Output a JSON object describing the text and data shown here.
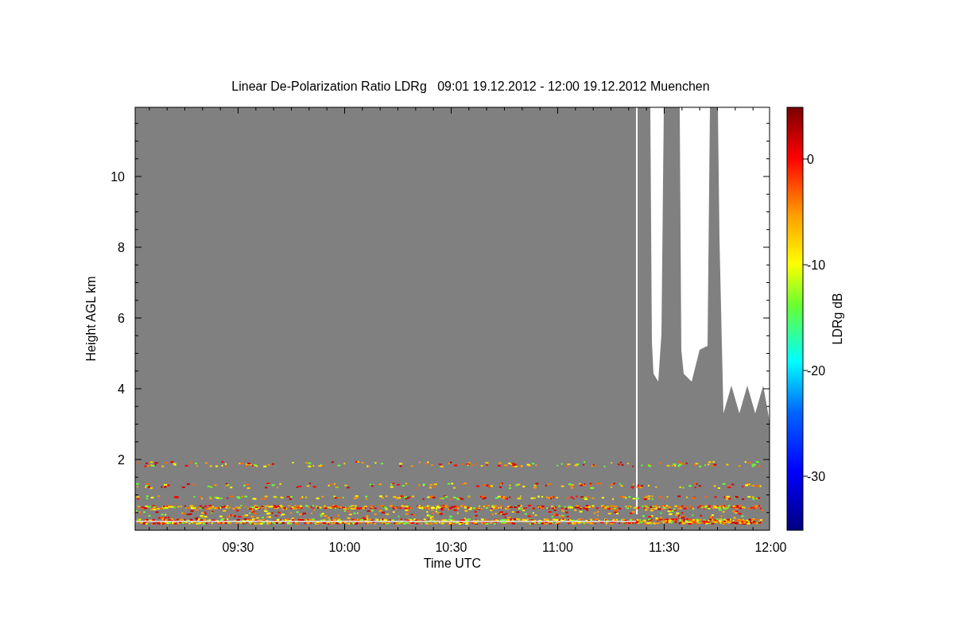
{
  "title": "Linear De-Polarization Ratio LDRg   09:01 19.12.2012 - 12:00 19.12.2012 Muenchen",
  "x_axis": {
    "label": "Time UTC",
    "ticks": [
      "09:30",
      "10:00",
      "10:30",
      "11:00",
      "11:30",
      "12:00"
    ]
  },
  "y_axis": {
    "label": "Height AGL km",
    "ticks": [
      "10",
      "8",
      "6",
      "4",
      "2"
    ]
  },
  "colorbar": {
    "label": "LDRg dB",
    "ticks": [
      "0",
      "-10",
      "-20",
      "-30"
    ]
  }
}
